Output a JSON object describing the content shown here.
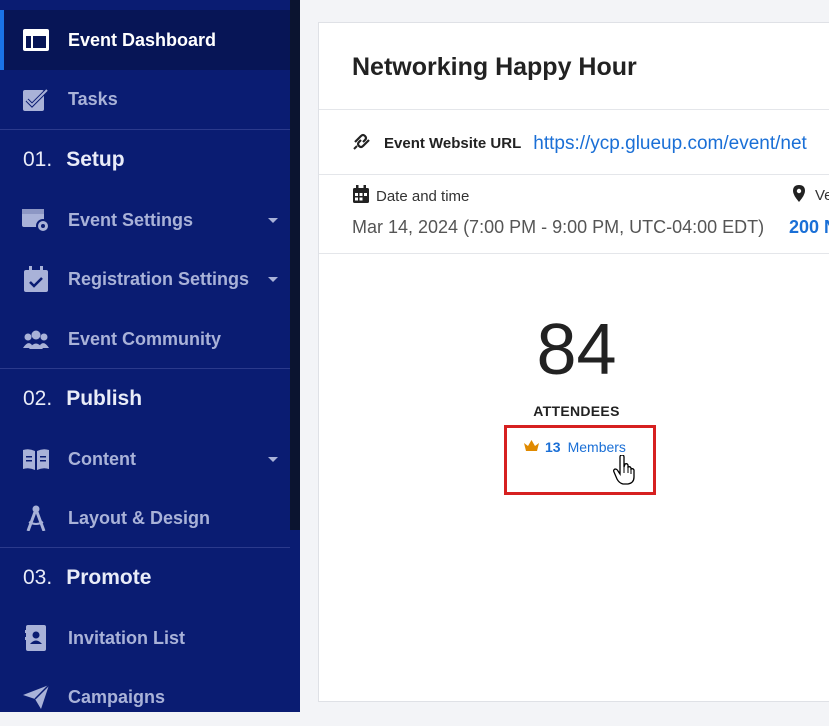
{
  "sidebar": {
    "items": [
      {
        "label": "Event Dashboard",
        "icon": "dashboard-icon"
      },
      {
        "label": "Tasks",
        "icon": "tasks-icon"
      },
      {
        "label": "Event Settings",
        "icon": "event-settings-icon"
      },
      {
        "label": "Registration Settings",
        "icon": "calendar-check-icon"
      },
      {
        "label": "Event Community",
        "icon": "community-icon"
      },
      {
        "label": "Content",
        "icon": "book-icon"
      },
      {
        "label": "Layout & Design",
        "icon": "compass-icon"
      },
      {
        "label": "Invitation List",
        "icon": "address-book-icon"
      },
      {
        "label": "Campaigns",
        "icon": "paper-plane-icon"
      }
    ],
    "sections": [
      {
        "num": "01.",
        "name": "Setup"
      },
      {
        "num": "02.",
        "name": "Publish"
      },
      {
        "num": "03.",
        "name": "Promote"
      }
    ]
  },
  "event": {
    "title": "Networking Happy Hour",
    "website_label": "Event Website URL",
    "website_url": "https://ycp.glueup.com/event/net",
    "datetime_label": "Date and time",
    "datetime_value": "Mar 14, 2024 (7:00 PM - 9:00 PM, UTC-04:00 EDT)",
    "venue_label": "Ve",
    "venue_value": "200 N"
  },
  "stats": {
    "attendee_count": "84",
    "attendee_label": "ATTENDEES",
    "members_count": "13",
    "members_label": "Members"
  },
  "colors": {
    "sidebar_bg": "#0a1c72",
    "accent": "#1a73e8",
    "link": "#1a6fd6",
    "highlight_box": "#d62020",
    "crown": "#e08a00"
  }
}
